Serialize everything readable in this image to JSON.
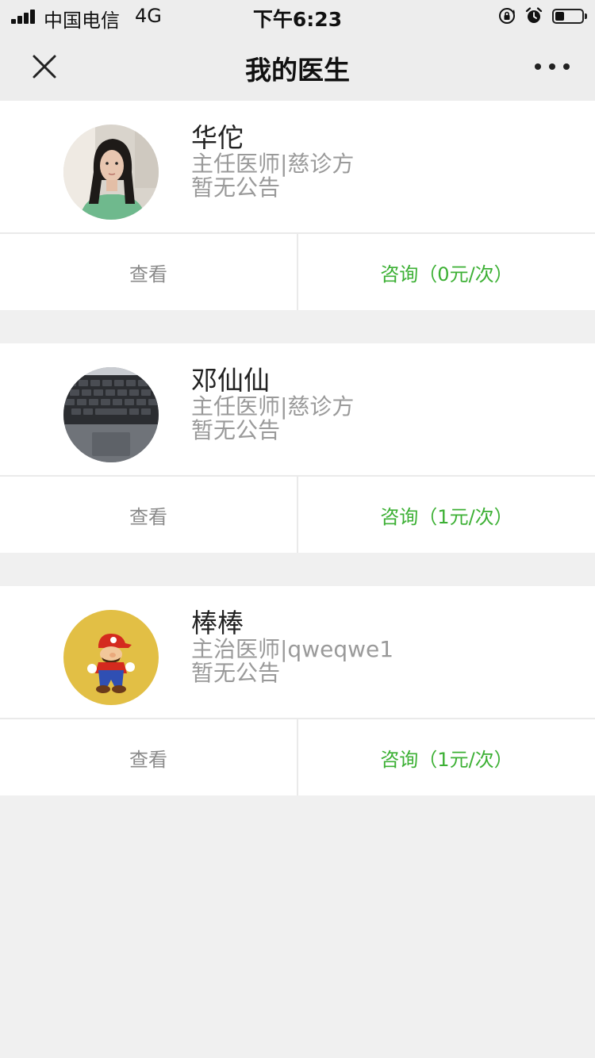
{
  "status_bar": {
    "carrier": "中国电信",
    "network": "4G",
    "time": "下午6:23",
    "battery_level": 0.35
  },
  "nav": {
    "title": "我的医生",
    "close_icon": "close-icon",
    "more_icon": "more-icon"
  },
  "doctors": [
    {
      "name": "华佗",
      "title": "主任医师|慈诊方",
      "notice": "暂无公告",
      "view_label": "查看",
      "consult_label": "咨询（0元/次）"
    },
    {
      "name": "邓仙仙",
      "title": "主任医师|慈诊方",
      "notice": "暂无公告",
      "view_label": "查看",
      "consult_label": "咨询（1元/次）"
    },
    {
      "name": "棒棒",
      "title": "主治医师|qweqwe1",
      "notice": "暂无公告",
      "view_label": "查看",
      "consult_label": "咨询（1元/次）"
    }
  ],
  "colors": {
    "accent_green": "#3cb034",
    "background": "#f0f0f0",
    "nav_background": "#ededed"
  }
}
